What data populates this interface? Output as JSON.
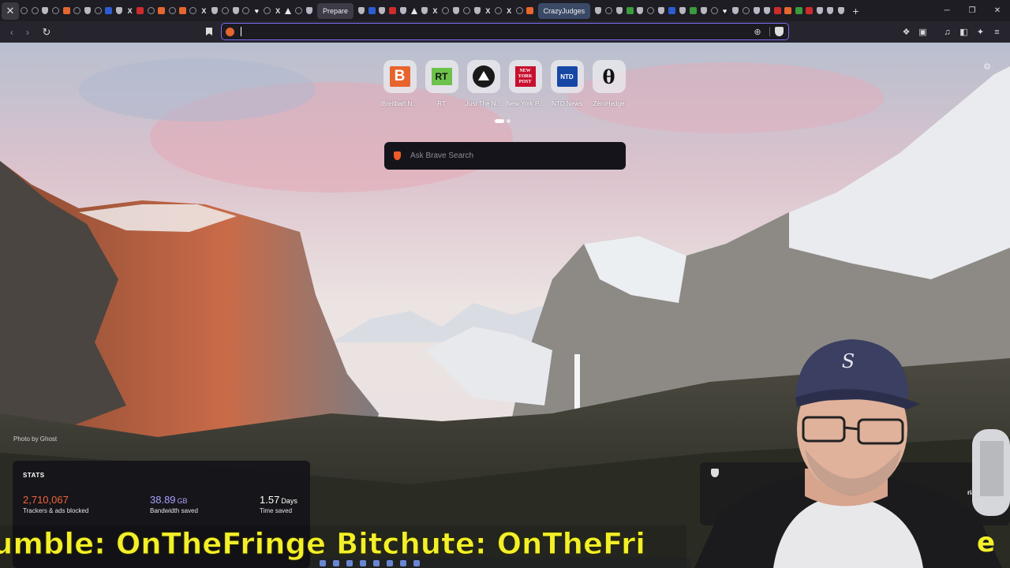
{
  "tabstrip": {
    "close_label": "✕",
    "named_tabs": [
      "Prepare",
      "CrazyJudges"
    ],
    "new_tab_label": "+",
    "window_controls": [
      "─",
      "❐",
      "✕"
    ]
  },
  "toolbar": {
    "url_value": "",
    "icons": [
      "back-icon",
      "forward-icon",
      "reload-icon",
      "bookmark-icon",
      "zoom-icon",
      "brave-shields-icon",
      "extensions-icon",
      "screenshot-icon",
      "media-icon",
      "sidebar-icon",
      "leo-ai-icon",
      "menu-icon"
    ]
  },
  "speed_dial": [
    {
      "label": "Breitbart N...",
      "icon": "breitbart-icon"
    },
    {
      "label": "RT",
      "icon": "rt-icon"
    },
    {
      "label": "Just The N...",
      "icon": "just-the-news-icon"
    },
    {
      "label": "New York P...",
      "icon": "new-york-post-icon"
    },
    {
      "label": "NTD News",
      "icon": "ntd-news-icon"
    },
    {
      "label": "ZeroHedge",
      "icon": "zerohedge-icon"
    }
  ],
  "logos": {
    "breitbart": "B",
    "rt": "RT",
    "nyp": "NEW YORK POST",
    "ntd": "NTD",
    "zerohedge": "θ"
  },
  "search": {
    "placeholder": "Ask Brave Search"
  },
  "photo_credit": "Photo by Ghost",
  "stats": {
    "title": "STATS",
    "trackers_value": "2,710,067",
    "trackers_label": "Trackers & ads blocked",
    "bandwidth_value": "38.89",
    "bandwidth_unit": "GB",
    "bandwidth_label": "Bandwidth saved",
    "time_value": "1.57",
    "time_unit": "Days",
    "time_label": "Time saved"
  },
  "brave_news": {
    "trial_label": "rial"
  },
  "ticker": {
    "text": "umble: OnTheFringe Bitchute: OnTheFri",
    "right_text": "e"
  },
  "colors": {
    "accent": "#7b6cf0",
    "trackers": "#f0643a",
    "bandwidth": "#a8a1ff",
    "ticker": "#f3ef2a"
  }
}
